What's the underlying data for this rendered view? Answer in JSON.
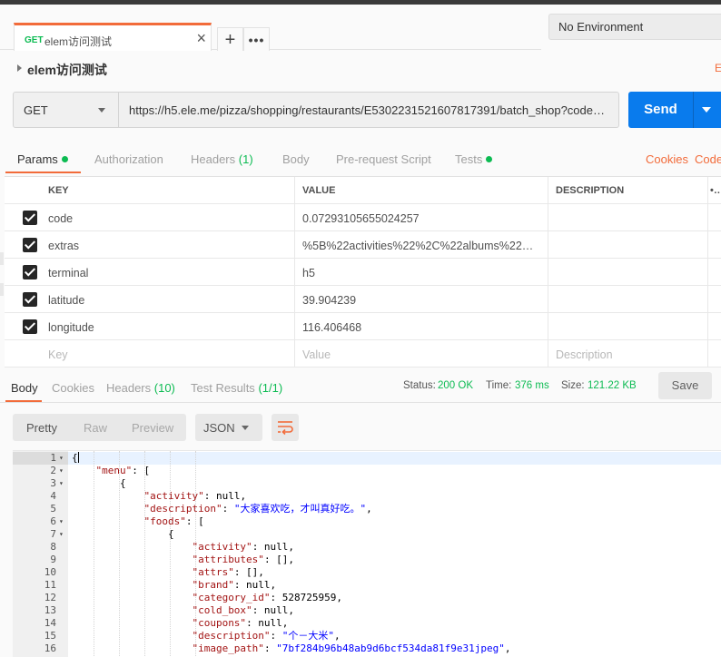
{
  "tab": {
    "method": "GET",
    "title": "elem访问测试",
    "close": "×",
    "add": "+",
    "more": "•••"
  },
  "environment": {
    "selected": "No Environment"
  },
  "request": {
    "name": "elem访问测试",
    "edge_label": "E",
    "method": "GET",
    "url": "https://h5.ele.me/pizza/shopping/restaurants/E5302231521607817391/batch_shop?code=0....",
    "send_label": "Send"
  },
  "request_tabs": {
    "params": "Params",
    "authorization": "Authorization",
    "headers": "Headers",
    "headers_count": "(1)",
    "body": "Body",
    "prerequest": "Pre-request Script",
    "tests": "Tests",
    "cookies": "Cookies",
    "code": "Code"
  },
  "params_table": {
    "headers": {
      "key": "KEY",
      "value": "VALUE",
      "description": "DESCRIPTION",
      "more": "•••"
    },
    "rows": [
      {
        "key": "code",
        "value": "0.07293105655024257",
        "description": ""
      },
      {
        "key": "extras",
        "value": "%5B%22activities%22%2C%22albums%22%2...",
        "description": ""
      },
      {
        "key": "terminal",
        "value": "h5",
        "description": ""
      },
      {
        "key": "latitude",
        "value": "39.904239",
        "description": ""
      },
      {
        "key": "longitude",
        "value": "116.406468",
        "description": ""
      }
    ],
    "placeholders": {
      "key": "Key",
      "value": "Value",
      "description": "Description"
    }
  },
  "response_tabs": {
    "body": "Body",
    "cookies": "Cookies",
    "headers": "Headers",
    "headers_count": "(10)",
    "test_results": "Test Results",
    "test_results_count": "(1/1)"
  },
  "status": {
    "status_label": "Status:",
    "status_value": "200 OK",
    "time_label": "Time:",
    "time_value": "376 ms",
    "size_label": "Size:",
    "size_value": "121.22 KB",
    "save_label": "Save"
  },
  "view": {
    "pretty": "Pretty",
    "raw": "Raw",
    "preview": "Preview",
    "format": "JSON"
  },
  "code_lines": [
    {
      "n": "1",
      "fold": "▾",
      "html": "{"
    },
    {
      "n": "2",
      "fold": "▾",
      "html": "    <span class='k'>\"menu\"</span>: ["
    },
    {
      "n": "3",
      "fold": "▾",
      "html": "        {"
    },
    {
      "n": "4",
      "fold": "",
      "html": "            <span class='k'>\"activity\"</span>: null,"
    },
    {
      "n": "5",
      "fold": "",
      "html": "            <span class='k'>\"description\"</span>: <span class='s'>\"大家喜欢吃，才叫真好吃。\"</span>,"
    },
    {
      "n": "6",
      "fold": "▾",
      "html": "            <span class='k'>\"foods\"</span>: ["
    },
    {
      "n": "7",
      "fold": "▾",
      "html": "                {"
    },
    {
      "n": "8",
      "fold": "",
      "html": "                    <span class='k'>\"activity\"</span>: null,"
    },
    {
      "n": "9",
      "fold": "",
      "html": "                    <span class='k'>\"attributes\"</span>: [],"
    },
    {
      "n": "10",
      "fold": "",
      "html": "                    <span class='k'>\"attrs\"</span>: [],"
    },
    {
      "n": "11",
      "fold": "",
      "html": "                    <span class='k'>\"brand\"</span>: null,"
    },
    {
      "n": "12",
      "fold": "",
      "html": "                    <span class='k'>\"category_id\"</span>: 528725959,"
    },
    {
      "n": "13",
      "fold": "",
      "html": "                    <span class='k'>\"cold_box\"</span>: null,"
    },
    {
      "n": "14",
      "fold": "",
      "html": "                    <span class='k'>\"coupons\"</span>: null,"
    },
    {
      "n": "15",
      "fold": "",
      "html": "                    <span class='k'>\"description\"</span>: <span class='s'>\"个－大米\"</span>,"
    },
    {
      "n": "16",
      "fold": "",
      "html": "                    <span class='k'>\"image_path\"</span>: <span class='s'>\"7bf284b96b48ab9d6bcf534da81f9e31jpeg\"</span>,"
    }
  ],
  "colors": {
    "accent": "#f26b3a",
    "send": "#097bed",
    "success": "#0cbb52"
  }
}
